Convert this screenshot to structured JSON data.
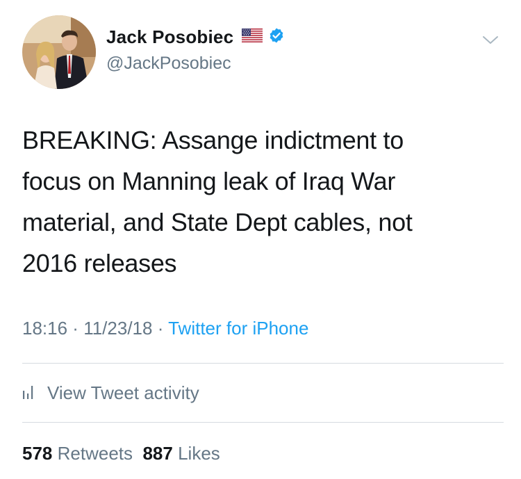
{
  "author": {
    "display_name": "Jack Posobiec",
    "handle": "@JackPosobiec",
    "flag_icon": "us-flag-icon",
    "verified_icon": "verified-badge-icon"
  },
  "tweet": {
    "text": "BREAKING: Assange indictment to\nfocus on Manning leak of Iraq War\nmaterial, and State Dept cables, not\n2016 releases",
    "time": "18:16",
    "date": "11/23/18",
    "separator": " · ",
    "source": "Twitter for iPhone"
  },
  "activity": {
    "label": "View Tweet activity",
    "icon": "bar-chart-icon"
  },
  "stats": {
    "retweets_count": "578",
    "retweets_label": "Retweets",
    "likes_count": "887",
    "likes_label": "Likes"
  },
  "colors": {
    "link": "#1da1f2",
    "secondary": "#657786",
    "primary": "#14171a",
    "divider": "#d6dbe0",
    "verified": "#1da1f2"
  }
}
